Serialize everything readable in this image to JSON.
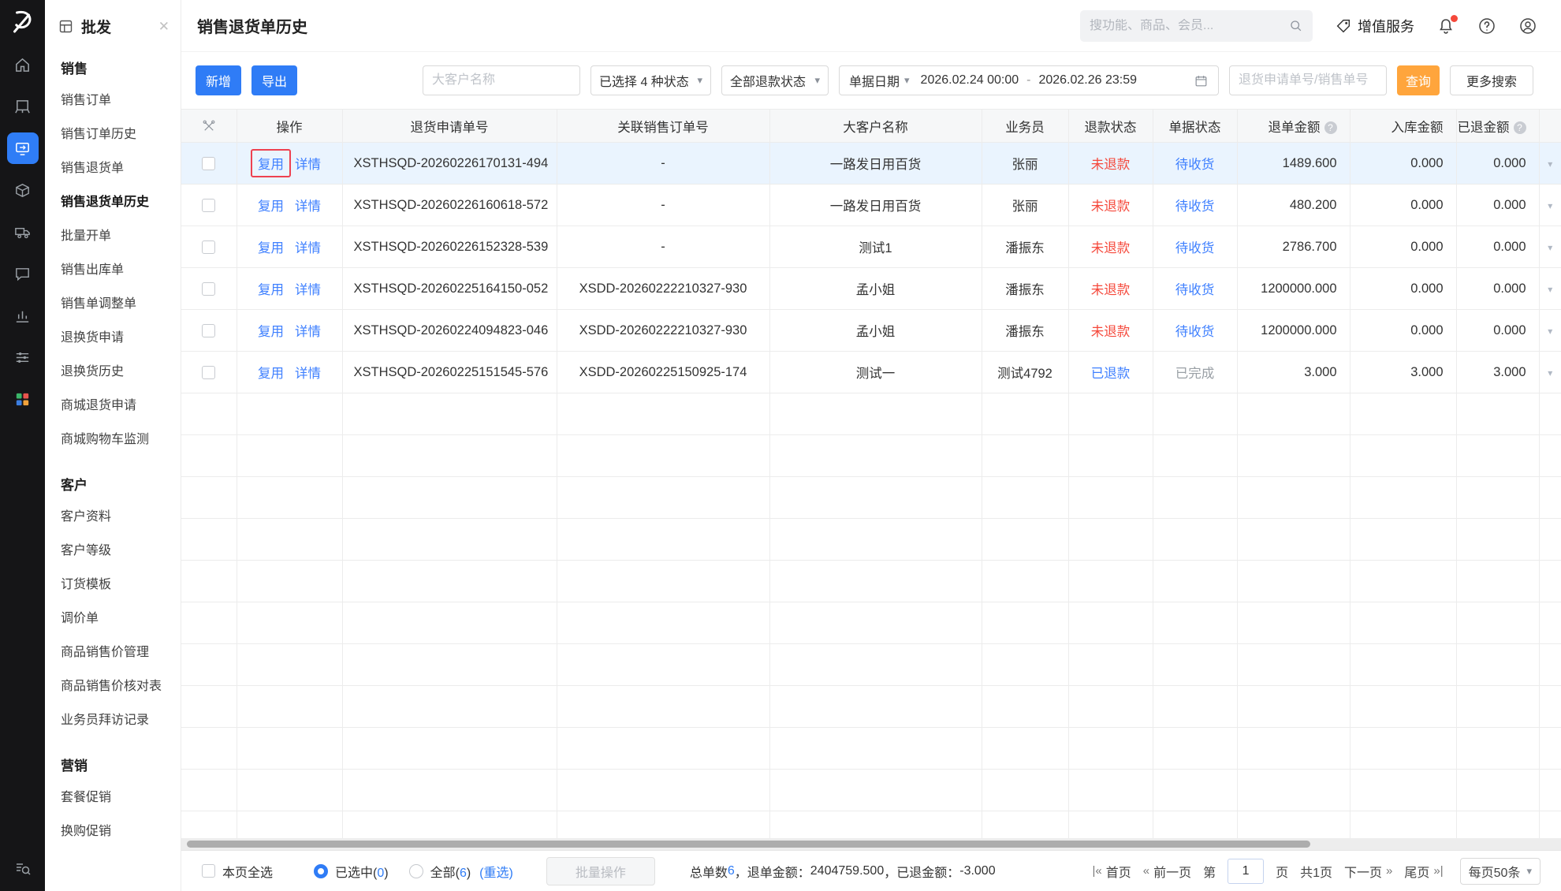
{
  "colors": {
    "accent_blue": "#2f7cf6",
    "link_blue": "#3f80ff",
    "danger_red": "#f5483b",
    "status_gray": "#9aa0a6",
    "query_orange": "#ffa53c",
    "row_highlight": "#eaf4fe",
    "annotation_red": "#ee4150"
  },
  "icons": {
    "caret_down": "▾",
    "close": "✕",
    "help": "?"
  },
  "sidebar": {
    "app_title": "批发",
    "sections": [
      {
        "title": "销售",
        "active": "销售退货单历史",
        "items": [
          "销售订单",
          "销售订单历史",
          "销售退货单",
          "销售退货单历史",
          "批量开单",
          "销售出库单",
          "销售单调整单",
          "退换货申请",
          "退换货历史",
          "商城退货申请",
          "商城购物车监测"
        ]
      },
      {
        "title": "客户",
        "items": [
          "客户资料",
          "客户等级",
          "订货模板",
          "调价单",
          "商品销售价管理",
          "商品销售价核对表",
          "业务员拜访记录"
        ]
      },
      {
        "title": "营销",
        "items": [
          "套餐促销",
          "换购促销"
        ]
      }
    ]
  },
  "header": {
    "page_title": "销售退货单历史",
    "search_placeholder": "搜功能、商品、会员...",
    "vas_label": "增值服务"
  },
  "toolbar": {
    "add_label": "新增",
    "export_label": "导出",
    "customer_placeholder": "大客户名称",
    "status_select": "已选择 4 种状态",
    "refund_select": "全部退款状态",
    "date_type": "单据日期",
    "date_start": "2026.02.24 00:00",
    "date_separator": "-",
    "date_end": "2026.02.26 23:59",
    "order_placeholder": "退货申请单号/销售单号",
    "query_label": "查询",
    "more_label": "更多搜索"
  },
  "table": {
    "copy_label": "复用",
    "detail_label": "详情",
    "columns": [
      "操作",
      "退货申请单号",
      "关联销售订单号",
      "大客户名称",
      "业务员",
      "退款状态",
      "单据状态",
      "退单金额",
      "入库金额",
      "已退金额"
    ],
    "empty_row_count": 11,
    "rows": [
      {
        "order_no": "XSTHSQD-20260226170131-494",
        "linked_no": "-",
        "customer": "一路发日用百货",
        "salesman": "张丽",
        "refund_status": "未退款",
        "refund_color": "#f5483b",
        "doc_status": "待收货",
        "doc_color": "#3f80ff",
        "return_amount": "1489.600",
        "inbound_amount": "0.000",
        "refunded_amount": "0.000",
        "highlighted": true,
        "copy_annotated": true
      },
      {
        "order_no": "XSTHSQD-20260226160618-572",
        "linked_no": "-",
        "customer": "一路发日用百货",
        "salesman": "张丽",
        "refund_status": "未退款",
        "refund_color": "#f5483b",
        "doc_status": "待收货",
        "doc_color": "#3f80ff",
        "return_amount": "480.200",
        "inbound_amount": "0.000",
        "refunded_amount": "0.000"
      },
      {
        "order_no": "XSTHSQD-20260226152328-539",
        "linked_no": "-",
        "customer": "测试1",
        "salesman": "潘振东",
        "refund_status": "未退款",
        "refund_color": "#f5483b",
        "doc_status": "待收货",
        "doc_color": "#3f80ff",
        "return_amount": "2786.700",
        "inbound_amount": "0.000",
        "refunded_amount": "0.000"
      },
      {
        "order_no": "XSTHSQD-20260225164150-052",
        "linked_no": "XSDD-20260222210327-930",
        "customer": "孟小姐",
        "salesman": "潘振东",
        "refund_status": "未退款",
        "refund_color": "#f5483b",
        "doc_status": "待收货",
        "doc_color": "#3f80ff",
        "return_amount": "1200000.000",
        "inbound_amount": "0.000",
        "refunded_amount": "0.000"
      },
      {
        "order_no": "XSTHSQD-20260224094823-046",
        "linked_no": "XSDD-20260222210327-930",
        "customer": "孟小姐",
        "salesman": "潘振东",
        "refund_status": "未退款",
        "refund_color": "#f5483b",
        "doc_status": "待收货",
        "doc_color": "#3f80ff",
        "return_amount": "1200000.000",
        "inbound_amount": "0.000",
        "refunded_amount": "0.000"
      },
      {
        "order_no": "XSTHSQD-20260225151545-576",
        "linked_no": "XSDD-20260225150925-174",
        "customer": "测试一",
        "salesman": "测试4792",
        "refund_status": "已退款",
        "refund_color": "#3f80ff",
        "doc_status": "已完成",
        "doc_color": "#9aa0a6",
        "return_amount": "3.000",
        "inbound_amount": "3.000",
        "refunded_amount": "3.000"
      }
    ]
  },
  "footer": {
    "select_all_label": "本页全选",
    "selected_prefix": "已选中(",
    "selected_count": "0",
    "paren_close": ")",
    "all_prefix": "全部(",
    "all_count": "6",
    "reselect_label": "(重选)",
    "batch_label": "批量操作",
    "summary": {
      "total_label": "总单数 ",
      "total_count": "6",
      "return_label": "，退单金额：",
      "return_amount": "2404759.500",
      "refunded_label": "，已退金额：",
      "refunded_amount": "-3.000"
    },
    "pagination": {
      "first_icon": "|«",
      "first_label": "首页",
      "prev_icon": "«",
      "prev_label": "前一页",
      "page_prefix": "第",
      "page_value": "1",
      "page_suffix": "页",
      "total_pages": "共1页",
      "next_label": "下一页",
      "next_icon": "»",
      "last_label": "尾页",
      "last_icon": "»|",
      "page_size": "每页50条"
    }
  }
}
